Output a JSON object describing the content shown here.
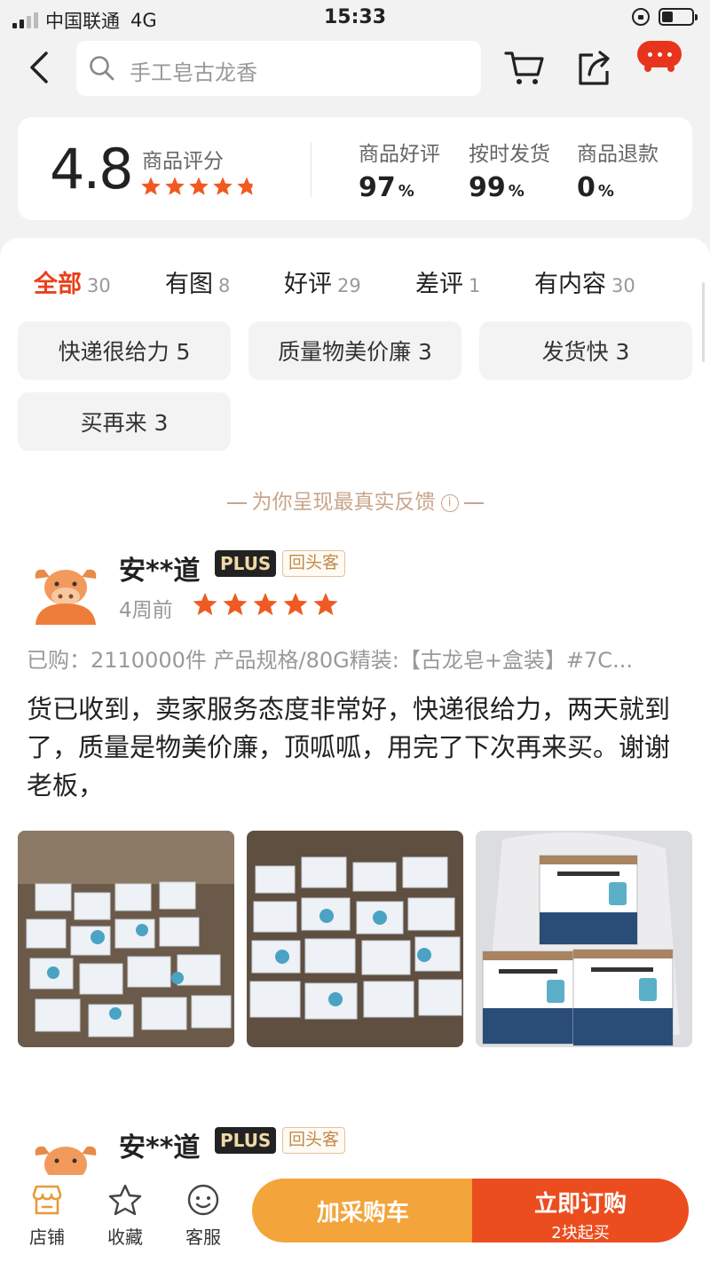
{
  "status_bar": {
    "carrier": "中国联通",
    "network": "4G",
    "time": "15:33"
  },
  "nav": {
    "search_placeholder": "手工皂古龙香"
  },
  "rating": {
    "score": "4.8",
    "score_label": "商品评分",
    "star_value": 4.8,
    "stats": [
      {
        "label": "商品好评",
        "value": "97",
        "unit": "%"
      },
      {
        "label": "按时发货",
        "value": "99",
        "unit": "%"
      },
      {
        "label": "商品退款",
        "value": "0",
        "unit": "%"
      }
    ]
  },
  "tabs": [
    {
      "label": "全部",
      "count": "30",
      "active": true
    },
    {
      "label": "有图",
      "count": "8"
    },
    {
      "label": "好评",
      "count": "29"
    },
    {
      "label": "差评",
      "count": "1"
    },
    {
      "label": "有内容",
      "count": "30"
    }
  ],
  "chips": [
    "快递很给力 5",
    "质量物美价廉 3",
    "发货快 3",
    "买再来 3"
  ],
  "notice": "为你呈现最真实反馈",
  "reviews": [
    {
      "user": "安**道",
      "plus_badge": "PLUS",
      "repeat_badge": "回头客",
      "time": "4周前",
      "stars": 5,
      "bought": "已购：2110000件  产品规格/80G精装:【古龙皂+盒装】#7C...",
      "text": "货已收到，卖家服务态度非常好，快递很给力，两天就到了，质量是物美价廉，顶呱呱，用完了下次再来买。谢谢老板，"
    },
    {
      "user": "安**道",
      "plus_badge": "PLUS",
      "repeat_badge": "回头客"
    }
  ],
  "bottom_bar": {
    "shop": "店铺",
    "favorite": "收藏",
    "service": "客服",
    "add_cart": "加采购车",
    "buy_now": "立即订购",
    "min_order": "2块起买"
  },
  "colors": {
    "accent_red": "#e8421c",
    "star": "#f05a22",
    "cart_button": "#f3a43a",
    "buy_button": "#eb4d1e",
    "badge_gold": "#c08a4e"
  }
}
